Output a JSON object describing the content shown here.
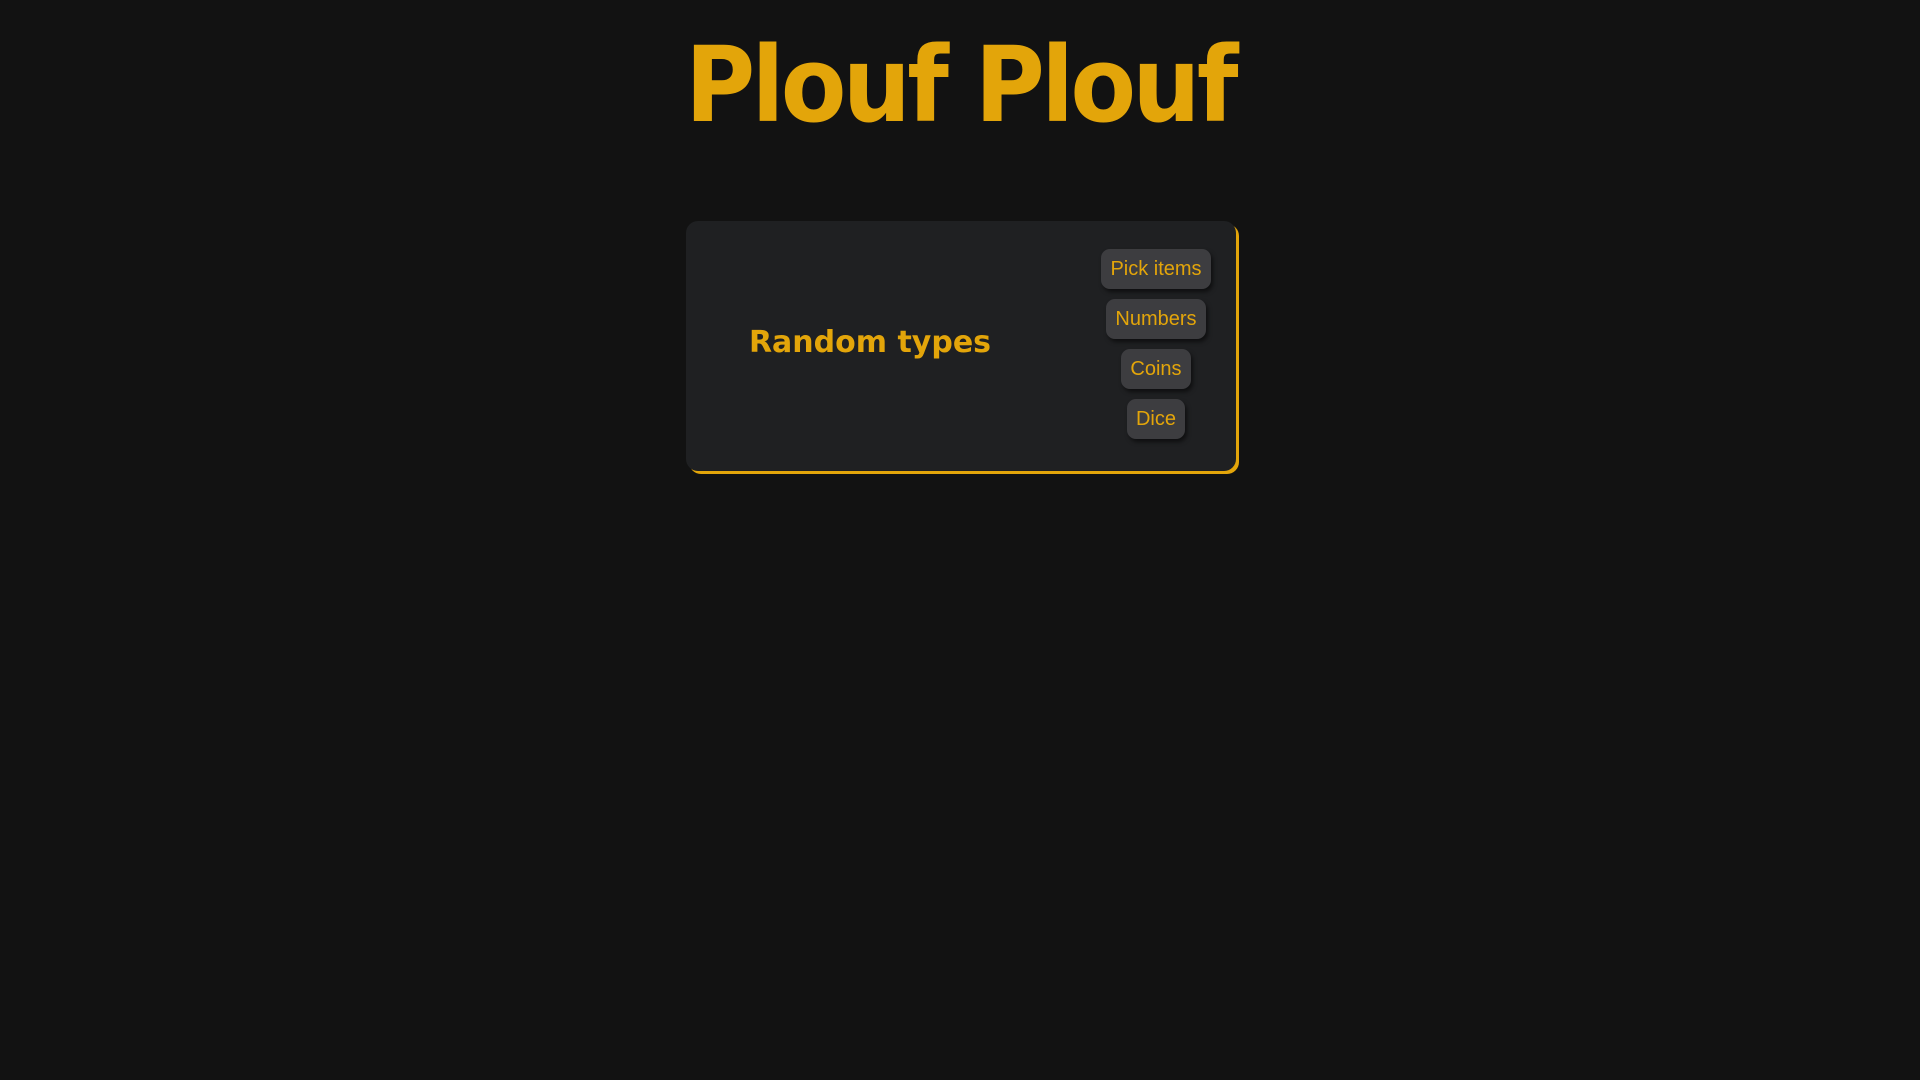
{
  "app": {
    "title": "Plouf Plouf"
  },
  "card": {
    "title": "Random types",
    "buttons": [
      {
        "label": "Pick items"
      },
      {
        "label": "Numbers"
      },
      {
        "label": "Coins"
      },
      {
        "label": "Dice"
      }
    ]
  },
  "colors": {
    "background": "#121212",
    "card_background": "#1f2022",
    "accent": "#e3a50a",
    "button_background": "#3d3d40"
  }
}
